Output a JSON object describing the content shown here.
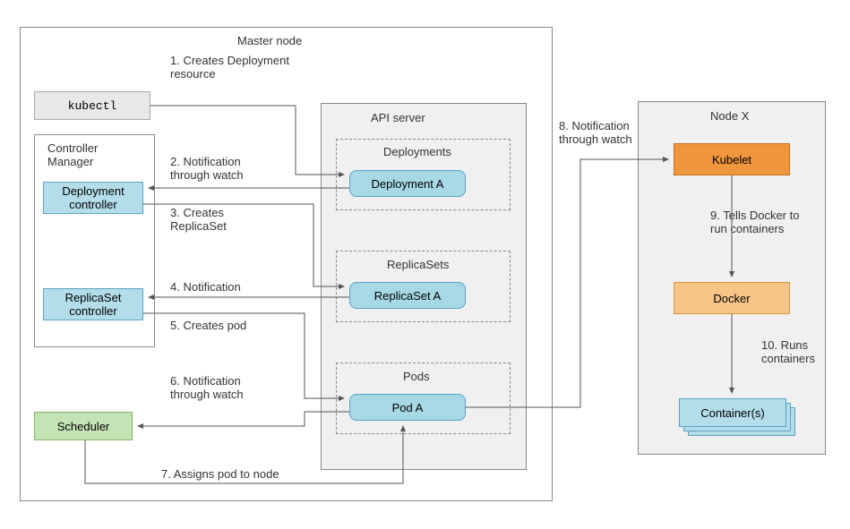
{
  "master": {
    "title": "Master node",
    "kubectl": "kubectl",
    "controllerManager": {
      "title": "Controller\nManager",
      "deploymentController": "Deployment\ncontroller",
      "replicaSetController": "ReplicaSet\ncontroller"
    },
    "scheduler": "Scheduler",
    "apiServer": {
      "title": "API server",
      "deployments": {
        "title": "Deployments",
        "item": "Deployment A"
      },
      "replicaSets": {
        "title": "ReplicaSets",
        "item": "ReplicaSet A"
      },
      "pods": {
        "title": "Pods",
        "item": "Pod A"
      }
    }
  },
  "nodeX": {
    "title": "Node X",
    "kubelet": "Kubelet",
    "docker": "Docker",
    "containers": "Container(s)"
  },
  "steps": {
    "s1": "1. Creates Deployment\nresource",
    "s2": "2. Notification\nthrough watch",
    "s3": "3. Creates\nReplicaSet",
    "s4": "4. Notification",
    "s5": "5. Creates pod",
    "s6": "6. Notification\nthrough watch",
    "s7": "7. Assigns pod to node",
    "s8": "8. Notification\nthrough watch",
    "s9": "9. Tells Docker to\nrun containers",
    "s10": "10. Runs\ncontainers"
  }
}
